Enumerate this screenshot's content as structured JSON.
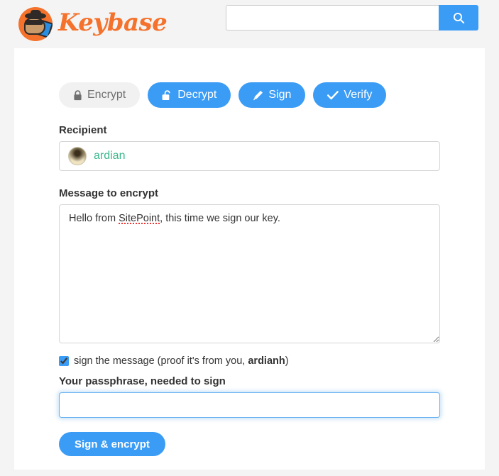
{
  "header": {
    "brand_name": "Keybase",
    "logo_icon": "keybase-spy-logo",
    "search": {
      "value": "",
      "placeholder": "",
      "button_icon": "search-icon"
    }
  },
  "tabs": [
    {
      "label": "Encrypt",
      "icon": "lock-closed-icon",
      "active": true
    },
    {
      "label": "Decrypt",
      "icon": "lock-open-icon",
      "active": false
    },
    {
      "label": "Sign",
      "icon": "pencil-icon",
      "active": false
    },
    {
      "label": "Verify",
      "icon": "check-icon",
      "active": false
    }
  ],
  "form": {
    "recipient_label": "Recipient",
    "recipient_value": "ardian",
    "recipient_avatar": "user-avatar",
    "message_label": "Message to encrypt",
    "message_value": "Hello from SitePoint, this time we sign our key.",
    "message_text_before": "Hello from ",
    "message_text_misspelled": "SitePoint",
    "message_text_after": ", this time we sign our key.",
    "sign_checkbox_checked": true,
    "sign_text_before": "sign the message (proof it's from you, ",
    "sign_username": "ardianh",
    "sign_text_after": ")",
    "passphrase_label": "Your passphrase, needed to sign",
    "passphrase_value": "",
    "passphrase_placeholder": "",
    "submit_label": "Sign & encrypt"
  },
  "colors": {
    "brand_orange": "#f4722b",
    "accent_blue": "#3b9cf5",
    "username_green": "#3ab88a",
    "page_background": "#f4f4f5",
    "card_background": "#ffffff",
    "inactive_tab": "#f1f1f1",
    "spellcheck_red": "#ee3333"
  }
}
